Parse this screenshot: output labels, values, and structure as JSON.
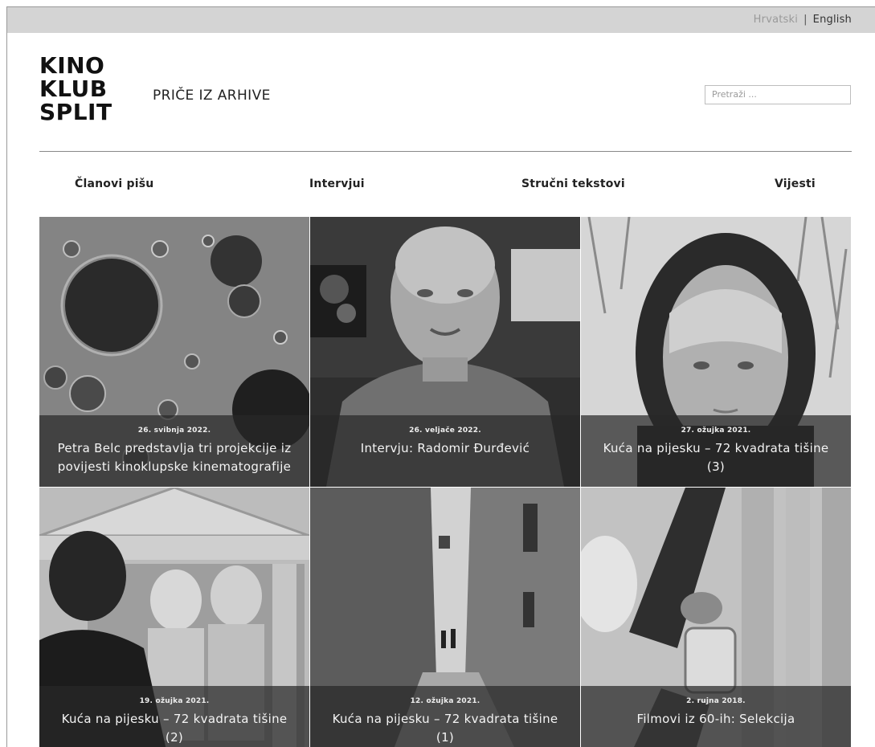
{
  "header": {
    "languages": [
      "Hrvatski",
      "English"
    ],
    "separator": "|",
    "logo_lines": [
      "KINO",
      "KLUB",
      "SPLIT"
    ],
    "site_title": "PRIČE IZ ARHIVE",
    "search_placeholder": "Pretraži ..."
  },
  "nav": {
    "items": [
      "Članovi pišu",
      "Intervjui",
      "Stručni tekstovi",
      "Vijesti"
    ]
  },
  "posts": [
    {
      "date": "26. svibnja 2022.",
      "title": "Petra Belc predstavlja tri projekcije iz povijesti kinoklupske kinematografije"
    },
    {
      "date": "26. veljače 2022.",
      "title": "Intervju: Radomir Đurđević"
    },
    {
      "date": "27. ožujka 2021.",
      "title": "Kuća na pijesku – 72 kvadrata tišine (3)"
    },
    {
      "date": "19. ožujka 2021.",
      "title": "Kuća na pijesku – 72 kvadrata tišine (2)"
    },
    {
      "date": "12. ožujka 2021.",
      "title": "Kuća na pijesku – 72 kvadrata tišine (1)"
    },
    {
      "date": "2. rujna 2018.",
      "title": "Filmovi iz 60-ih: Selekcija"
    }
  ],
  "colors": {
    "topbar": "#d4d4d4",
    "caption_overlay": "#282828"
  }
}
